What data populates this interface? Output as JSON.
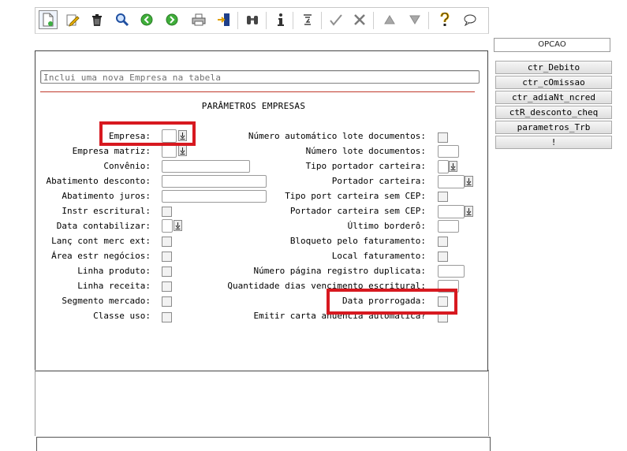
{
  "toolbar": {
    "icons": [
      "new-document-icon",
      "edit-pencil-icon",
      "trash-icon",
      "magnifier-icon",
      "back-green-icon",
      "forward-green-icon",
      "printer-icon",
      "exit-door-icon",
      "binoculars-icon",
      "info-icon",
      "sigma-icon",
      "check-icon",
      "scissors-icon",
      "triangle-up-icon",
      "triangle-down-icon",
      "help-question-icon",
      "speech-bubble-icon"
    ]
  },
  "status_message": "Inclui uma nova Empresa na tabela",
  "form": {
    "title": "PARÂMETROS EMPRESAS",
    "left": [
      {
        "label": "Empresa:"
      },
      {
        "label": "Empresa matriz:"
      },
      {
        "label": "Convênio:"
      },
      {
        "label": "Abatimento desconto:"
      },
      {
        "label": "Abatimento juros:"
      },
      {
        "label": "Instr escritural:"
      },
      {
        "label": "Data contabilizar:"
      },
      {
        "label": "Lanç cont merc ext:"
      },
      {
        "label": "Área estr negócios:"
      },
      {
        "label": "Linha produto:"
      },
      {
        "label": "Linha receita:"
      },
      {
        "label": "Segmento mercado:"
      },
      {
        "label": "Classe uso:"
      }
    ],
    "right": [
      {
        "label": "Número automático lote documentos:"
      },
      {
        "label": "Número lote documentos:"
      },
      {
        "label": "Tipo portador carteira:"
      },
      {
        "label": "Portador carteira:"
      },
      {
        "label": "Tipo port carteira sem CEP:"
      },
      {
        "label": "Portador carteira sem CEP:"
      },
      {
        "label": "Último borderô:"
      },
      {
        "label": "Bloqueto pelo faturamento:"
      },
      {
        "label": "Local faturamento:"
      },
      {
        "label": "Número página registro duplicata:"
      },
      {
        "label": "Quantidade dias vencimento escritural:"
      },
      {
        "label": "Data prorrogada:"
      },
      {
        "label": "Emitir carta anuência automática?"
      }
    ]
  },
  "options": {
    "header": "OPCAO",
    "items": [
      "ctr_Debito",
      "ctr_cOmissao",
      "ctr_adiaNt_ncred",
      "ctR_desconto_cheq",
      "parametros_Trb",
      "!"
    ]
  },
  "colors": {
    "highlight": "#d71920",
    "rule": "#c0392b"
  }
}
